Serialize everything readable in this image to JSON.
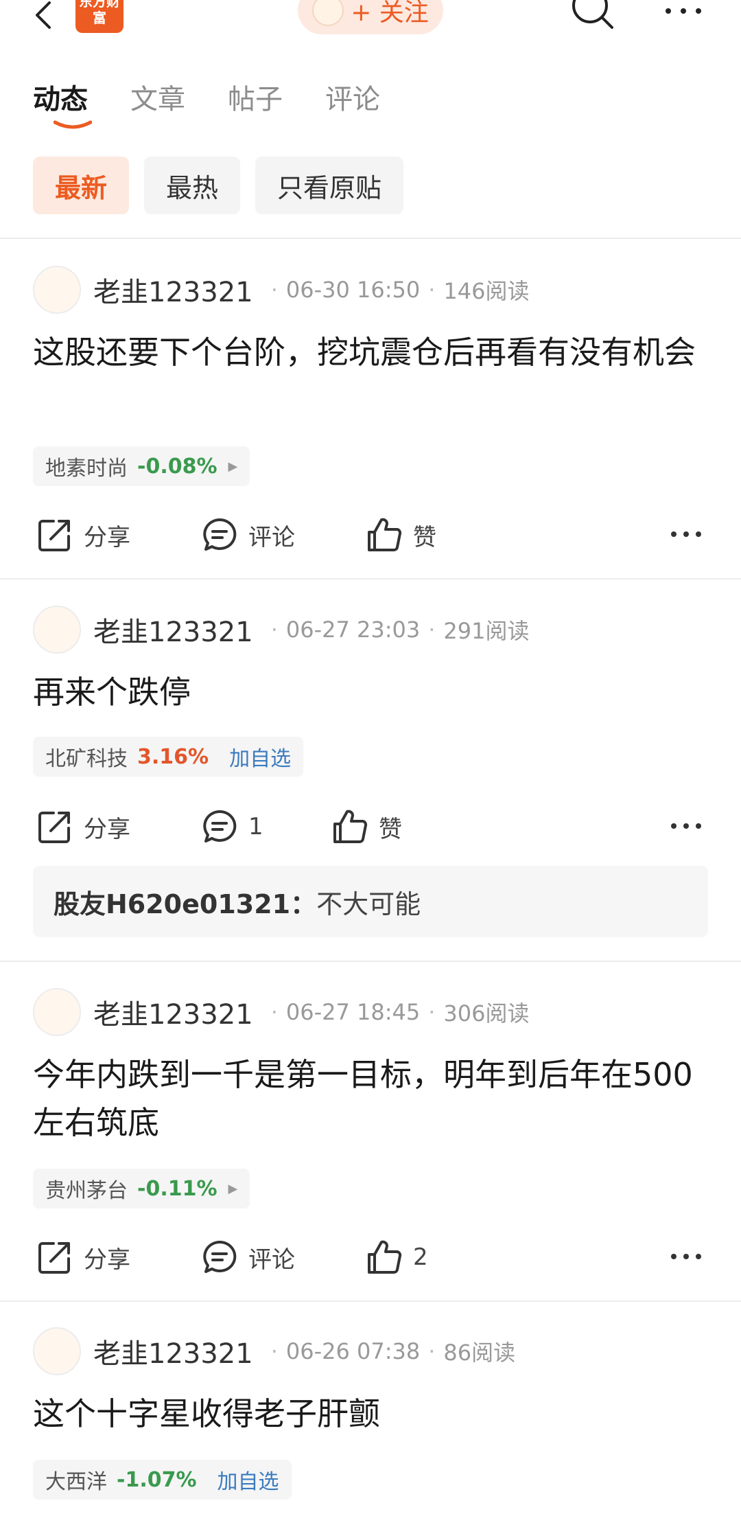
{
  "header": {
    "logo_text": "东方财富",
    "follow_label": "+ 关注"
  },
  "tabs": [
    {
      "label": "动态",
      "active": true
    },
    {
      "label": "文章",
      "active": false
    },
    {
      "label": "帖子",
      "active": false
    },
    {
      "label": "评论",
      "active": false
    }
  ],
  "filters": [
    {
      "label": "最新",
      "active": true
    },
    {
      "label": "最热",
      "active": false
    },
    {
      "label": "只看原贴",
      "active": false
    }
  ],
  "actions": {
    "share_label": "分享",
    "comment_label": "评论",
    "like_label": "赞"
  },
  "posts": [
    {
      "author": "老韭123321",
      "time": "06-30 16:50",
      "reads": "146阅读",
      "content": "这股还要下个台阶，挖坑震仓后再看有没有机会",
      "stock": {
        "name": "地素时尚",
        "pct": "-0.08%",
        "direction": "down",
        "add_label": ""
      },
      "comment_text": "评论",
      "like_text": "赞",
      "reply": null
    },
    {
      "author": "老韭123321",
      "time": "06-27 23:03",
      "reads": "291阅读",
      "content": "再来个跌停",
      "stock": {
        "name": "北矿科技",
        "pct": "3.16%",
        "direction": "up",
        "add_label": "加自选"
      },
      "comment_text": "1",
      "like_text": "赞",
      "reply": {
        "user": "股友H620e01321：",
        "text": "不大可能"
      }
    },
    {
      "author": "老韭123321",
      "time": "06-27 18:45",
      "reads": "306阅读",
      "content": "今年内跌到一千是第一目标，明年到后年在500左右筑底",
      "stock": {
        "name": "贵州茅台",
        "pct": "-0.11%",
        "direction": "down",
        "add_label": ""
      },
      "comment_text": "评论",
      "like_text": "2",
      "reply": null
    },
    {
      "author": "老韭123321",
      "time": "06-26 07:38",
      "reads": "86阅读",
      "content": "这个十字星收得老子肝颤",
      "stock": {
        "name": "大西洋",
        "pct": "-1.07%",
        "direction": "down",
        "add_label": "加自选"
      },
      "comment_text": "",
      "like_text": "",
      "reply": null
    }
  ],
  "colors": {
    "brand": "#ec5b22",
    "up": "#e2562b",
    "down": "#3a9a4e",
    "link": "#3b7bbf"
  }
}
